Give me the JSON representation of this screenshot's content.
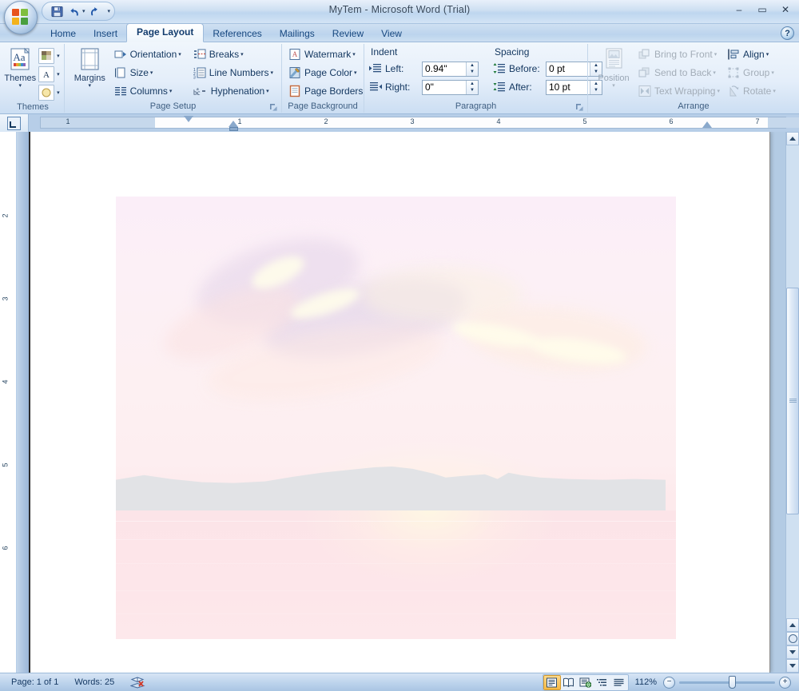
{
  "window": {
    "title": "MyTem - Microsoft Word (Trial)",
    "minimize_label": "–",
    "maximize_label": "▭",
    "close_label": "✕"
  },
  "quick_access": {
    "save_label": "Save",
    "undo_label": "Undo",
    "redo_label": "Redo",
    "customize_label": "Customize Quick Access Toolbar",
    "caret": "▾"
  },
  "office_button": {
    "label": "Office Button"
  },
  "help_button": {
    "label": "?"
  },
  "tabs": [
    {
      "label": "Home",
      "active": false
    },
    {
      "label": "Insert",
      "active": false
    },
    {
      "label": "Page Layout",
      "active": true
    },
    {
      "label": "References",
      "active": false
    },
    {
      "label": "Mailings",
      "active": false
    },
    {
      "label": "Review",
      "active": false
    },
    {
      "label": "View",
      "active": false
    }
  ],
  "ribbon": {
    "groups": [
      {
        "name": "Themes",
        "label": "Themes",
        "big_buttons": [
          {
            "label": "Themes",
            "caret": "▾",
            "disabled": false
          }
        ],
        "tiny_buttons": [
          {
            "name": "theme-colors",
            "caret": "▾"
          },
          {
            "name": "theme-fonts",
            "caret": "▾",
            "glyph": "A"
          },
          {
            "name": "theme-effects",
            "caret": "▾"
          }
        ]
      },
      {
        "name": "Page Setup",
        "label": "Page Setup",
        "big_buttons": [
          {
            "label": "Margins",
            "caret": "▾",
            "disabled": false
          }
        ],
        "small_buttons": [
          {
            "label": "Orientation",
            "caret": "▾"
          },
          {
            "label": "Size",
            "caret": "▾"
          },
          {
            "label": "Columns",
            "caret": "▾"
          },
          {
            "label": "Breaks",
            "caret": "▾"
          },
          {
            "label": "Line Numbers",
            "caret": "▾"
          },
          {
            "label": "Hyphenation",
            "caret": "▾"
          }
        ],
        "has_dialog_launcher": true
      },
      {
        "name": "Page Background",
        "label": "Page Background",
        "small_buttons": [
          {
            "label": "Watermark",
            "caret": "▾"
          },
          {
            "label": "Page Color",
            "caret": "▾"
          },
          {
            "label": "Page Borders",
            "caret": ""
          }
        ]
      },
      {
        "name": "Paragraph",
        "label": "Paragraph",
        "indent_heading": "Indent",
        "spacing_heading": "Spacing",
        "fields": [
          {
            "label": "Left:",
            "value": "0.94\""
          },
          {
            "label": "Right:",
            "value": "0\""
          },
          {
            "label": "Before:",
            "value": "0 pt"
          },
          {
            "label": "After:",
            "value": "10 pt"
          }
        ],
        "has_dialog_launcher": true
      },
      {
        "name": "Arrange",
        "label": "Arrange",
        "big_buttons": [
          {
            "label": "Position",
            "caret": "▾",
            "disabled": true
          }
        ],
        "small_buttons": [
          {
            "label": "Bring to Front",
            "caret": "▾",
            "disabled": true
          },
          {
            "label": "Send to Back",
            "caret": "▾",
            "disabled": true
          },
          {
            "label": "Text Wrapping",
            "caret": "▾",
            "disabled": true
          },
          {
            "label": "Align",
            "caret": "▾",
            "disabled": false
          },
          {
            "label": "Group",
            "caret": "▾",
            "disabled": true
          },
          {
            "label": "Rotate",
            "caret": "▾",
            "disabled": true
          }
        ]
      }
    ]
  },
  "ruler": {
    "tab_selector_label": "Left Tab",
    "h_numbers": [
      "1",
      "1",
      "2",
      "3",
      "4",
      "5",
      "6",
      "7"
    ],
    "v_numbers": [
      "2",
      "3",
      "4",
      "5",
      "6"
    ],
    "first_line_indent": "0.94\"",
    "left_indent": "0.94\"",
    "right_indent": "6.5\""
  },
  "document": {
    "image_alt": "sunset over water with mountain silhouette"
  },
  "status": {
    "page": "Page: 1 of 1",
    "words": "Words: 25",
    "proofing": "Proofing errors",
    "zoom": "112%",
    "zoom_out_label": "−",
    "zoom_in_label": "+",
    "views": [
      {
        "name": "print-layout",
        "label": "Print Layout",
        "active": true
      },
      {
        "name": "full-screen-reading",
        "label": "Full Screen Reading",
        "active": false
      },
      {
        "name": "web-layout",
        "label": "Web Layout",
        "active": false
      },
      {
        "name": "outline",
        "label": "Outline",
        "active": false
      },
      {
        "name": "draft",
        "label": "Draft",
        "active": false
      }
    ]
  },
  "colors": {
    "accent": "#1f3c63",
    "chrome": "#bcd4ed",
    "tab_active": "#ffffff",
    "disabled_text": "#a3adb8"
  }
}
